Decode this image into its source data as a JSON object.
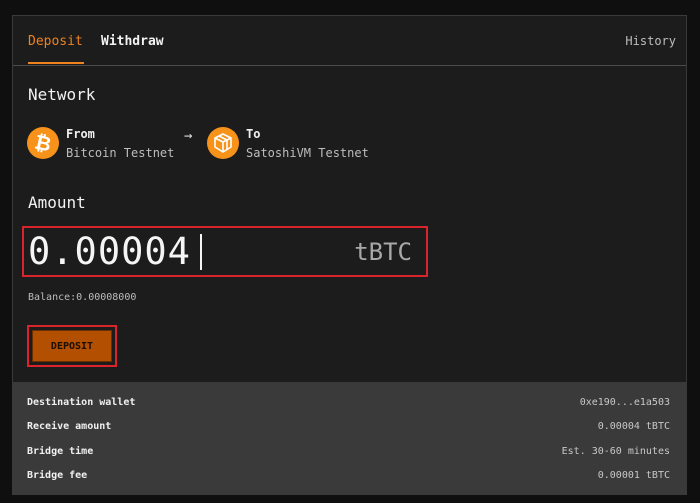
{
  "tabs": {
    "deposit": "Deposit",
    "withdraw": "Withdraw",
    "history": "History"
  },
  "network": {
    "title": "Network",
    "from_label": "From",
    "from_value": "Bitcoin Testnet",
    "to_label": "To",
    "to_value": "SatoshiVM Testnet",
    "from_icon": "bitcoin-icon",
    "to_icon": "satoshivm-icon",
    "arrow": "→"
  },
  "amount": {
    "title": "Amount",
    "value": "0.00004",
    "unit": "tBTC",
    "balance": "Balance:0.00008000"
  },
  "deposit_button": "DEPOSIT",
  "details": [
    {
      "label": "Destination wallet",
      "value": "0xe190...e1a503"
    },
    {
      "label": "Receive amount",
      "value": "0.00004 tBTC"
    },
    {
      "label": "Bridge time",
      "value": "Est. 30-60 minutes"
    },
    {
      "label": "Bridge fee",
      "value": "0.00001 tBTC"
    }
  ],
  "colors": {
    "accent": "#f0821e",
    "button": "#b34f00",
    "highlight": "#d9232d",
    "coin": "#f7931a"
  }
}
